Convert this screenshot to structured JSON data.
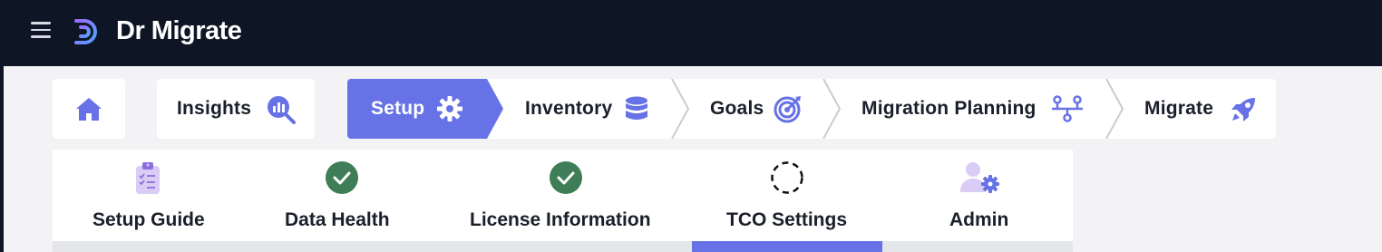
{
  "app": {
    "title": "Dr Migrate"
  },
  "nav": {
    "home_icon": "home-icon",
    "insights": {
      "label": "Insights",
      "icon": "chart-search-icon"
    },
    "steps": [
      {
        "label": "Setup",
        "icon": "gear-icon",
        "active": true
      },
      {
        "label": "Inventory",
        "icon": "database-icon",
        "active": false
      },
      {
        "label": "Goals",
        "icon": "target-icon",
        "active": false
      },
      {
        "label": "Migration Planning",
        "icon": "flow-icon",
        "active": false
      },
      {
        "label": "Migrate",
        "icon": "rocket-icon",
        "active": false
      }
    ]
  },
  "subtabs": [
    {
      "label": "Setup Guide",
      "icon": "clipboard-checklist-icon",
      "status": "none"
    },
    {
      "label": "Data Health",
      "icon": "check-circle-icon",
      "status": "complete"
    },
    {
      "label": "License Information",
      "icon": "check-circle-icon",
      "status": "complete"
    },
    {
      "label": "TCO Settings",
      "icon": "dashed-circle-icon",
      "status": "in-progress",
      "selected": true
    },
    {
      "label": "Admin",
      "icon": "user-gear-icon",
      "status": "none"
    }
  ],
  "colors": {
    "accent": "#6672e5",
    "topbar": "#0e1525",
    "success": "#3f7d58"
  }
}
